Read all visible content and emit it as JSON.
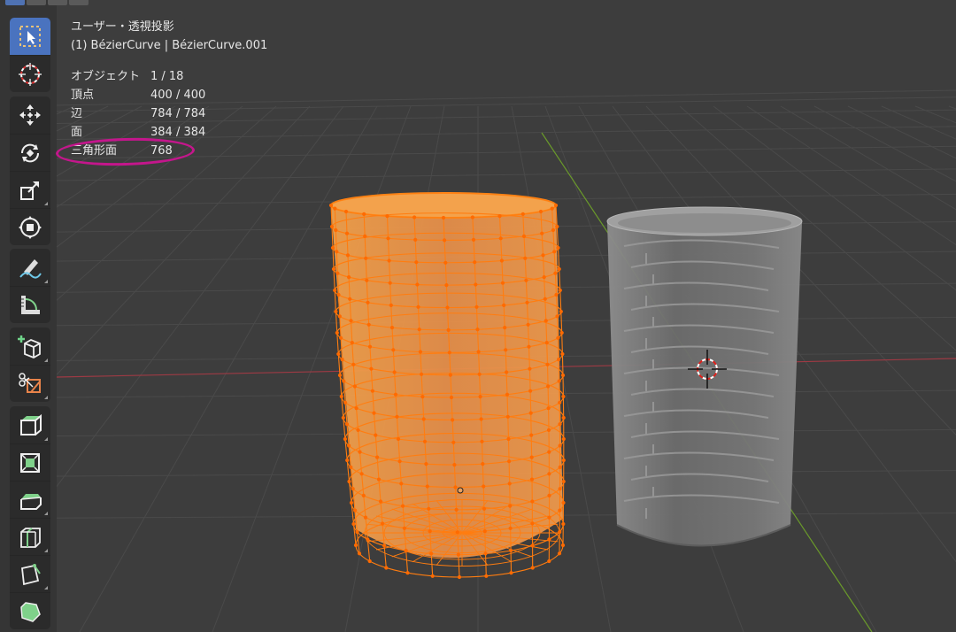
{
  "viewport": {
    "view_title": "ユーザー・透視投影",
    "object_name": "(1) BézierCurve | BézierCurve.001",
    "stats": [
      {
        "label": "オブジェクト",
        "value": "1 / 18"
      },
      {
        "label": "頂点",
        "value": "400 / 400"
      },
      {
        "label": "辺",
        "value": "784 / 784"
      },
      {
        "label": "面",
        "value": "384 / 384"
      },
      {
        "label": "三角形面",
        "value": "768"
      }
    ]
  },
  "toolbar": {
    "tools": [
      {
        "name": "select-box",
        "icon": "select-box-icon",
        "active": true
      },
      {
        "name": "cursor",
        "icon": "cursor-icon"
      },
      {
        "name": "move",
        "icon": "move-icon"
      },
      {
        "name": "rotate",
        "icon": "rotate-icon"
      },
      {
        "name": "scale",
        "icon": "scale-icon"
      },
      {
        "name": "transform",
        "icon": "transform-icon"
      },
      {
        "name": "annotate",
        "icon": "annotate-icon"
      },
      {
        "name": "measure",
        "icon": "measure-icon"
      },
      {
        "name": "add-cube",
        "icon": "add-cube-icon"
      },
      {
        "name": "knife",
        "icon": "knife-icon"
      },
      {
        "name": "extrude",
        "icon": "extrude-icon"
      },
      {
        "name": "inset",
        "icon": "inset-icon"
      },
      {
        "name": "bevel",
        "icon": "bevel-icon"
      },
      {
        "name": "loop-cut",
        "icon": "loop-cut-icon"
      },
      {
        "name": "poly-build",
        "icon": "poly-build-icon"
      },
      {
        "name": "shrink-fatten",
        "icon": "shrink-fatten-icon"
      }
    ]
  },
  "colors": {
    "background": "#3d3d3d",
    "selection_orange": "#ff8a1a",
    "highlight_annotation": "#c4168c",
    "x_axis": "#9e3a44",
    "y_axis": "#6a9a2a",
    "active_tool": "#4a73bf"
  }
}
